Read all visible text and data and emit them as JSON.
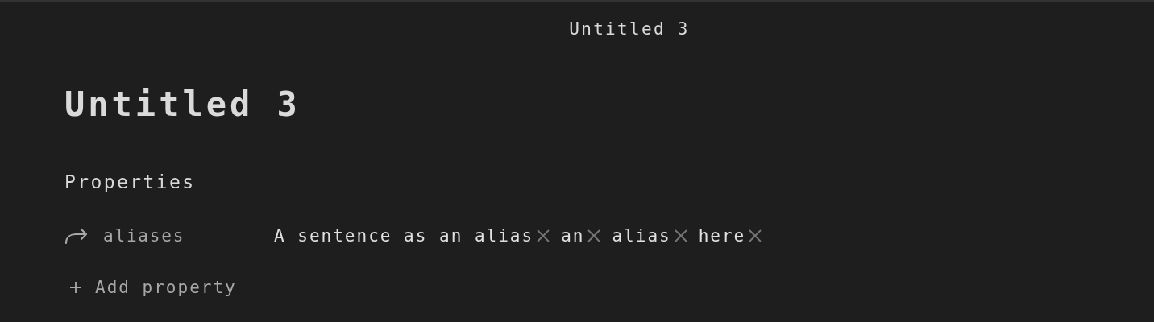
{
  "tab_title": "Untitled 3",
  "note": {
    "title": "Untitled 3"
  },
  "properties": {
    "heading": "Properties",
    "items": [
      {
        "name": "aliases",
        "values": [
          "A sentence as an alias",
          "an",
          "alias",
          "here"
        ]
      }
    ],
    "add_label": "Add property"
  }
}
